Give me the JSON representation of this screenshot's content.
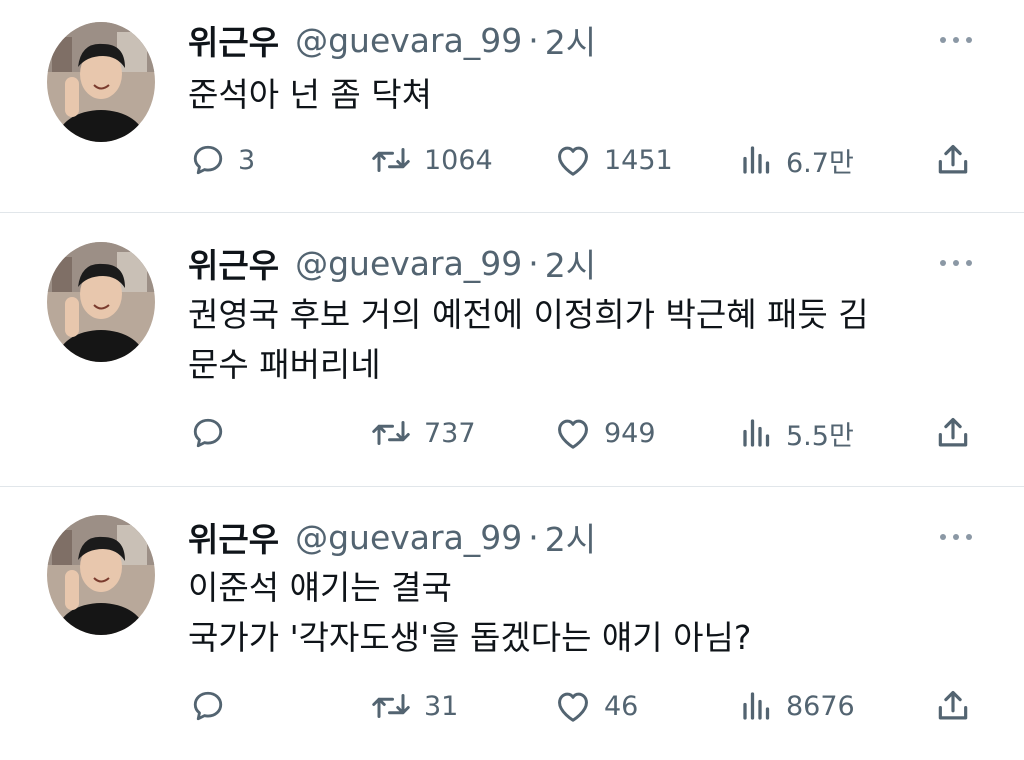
{
  "tweets": [
    {
      "name": "위근우",
      "handle": "@guevara_99",
      "separator": "·",
      "time": "2시",
      "lines": [
        "준석아 넌 좀 닥쳐"
      ],
      "replies": "3",
      "retweets": "1064",
      "likes": "1451",
      "views": "6.7만"
    },
    {
      "name": "위근우",
      "handle": "@guevara_99",
      "separator": "·",
      "time": "2시",
      "lines": [
        "권영국 후보 거의 예전에 이정희가 박근혜 패듯 김",
        "문수 패버리네"
      ],
      "replies": "",
      "retweets": "737",
      "likes": "949",
      "views": "5.5만"
    },
    {
      "name": "위근우",
      "handle": "@guevara_99",
      "separator": "·",
      "time": "2시",
      "lines": [
        "이준석 얘기는 결국",
        "국가가 '각자도생'을 돕겠다는 얘기 아님?"
      ],
      "replies": "",
      "retweets": "31",
      "likes": "46",
      "views": "8676"
    }
  ],
  "icons": {
    "reply": "reply-icon",
    "retweet": "retweet-icon",
    "like": "heart-icon",
    "views": "views-icon",
    "share": "share-icon",
    "more": "more-icon"
  },
  "colors": {
    "text": "#0f1419",
    "secondary": "#536471",
    "divider": "#e1e6ea"
  }
}
